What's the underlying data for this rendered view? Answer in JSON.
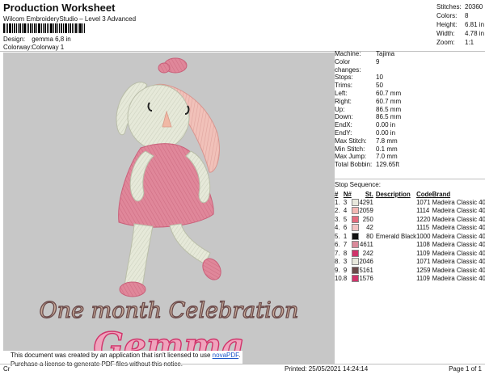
{
  "header": {
    "title": "Production Worksheet",
    "software": "Wilcom EmbroideryStudio – Level 3 Advanced",
    "design_label": "Design:",
    "design_value": "gemma 6,8 in",
    "colorway_label": "Colorway:",
    "colorway_value": "Colorway 1"
  },
  "stats": [
    {
      "k": "Stitches:",
      "v": "20360"
    },
    {
      "k": "Colors:",
      "v": "8"
    },
    {
      "k": "Height:",
      "v": "6.81 in"
    },
    {
      "k": "Width:",
      "v": "4.78 in"
    },
    {
      "k": "Zoom:",
      "v": "1:1"
    }
  ],
  "info": [
    {
      "k": "Machine:",
      "v": "Tajima"
    },
    {
      "k": "Color changes:",
      "v": "9"
    },
    {
      "k": "Stops:",
      "v": "10"
    },
    {
      "k": "Trims:",
      "v": "50"
    },
    {
      "k": "Left:",
      "v": "60.7 mm"
    },
    {
      "k": "Right:",
      "v": "60.7 mm"
    },
    {
      "k": "Up:",
      "v": "86.5 mm"
    },
    {
      "k": "Down:",
      "v": "86.5 mm"
    },
    {
      "k": "EndX:",
      "v": "0.00 in"
    },
    {
      "k": "EndY:",
      "v": "0.00 in"
    },
    {
      "k": "Max Stitch:",
      "v": "7.8 mm"
    },
    {
      "k": "Min Stitch:",
      "v": "0.1 mm"
    },
    {
      "k": "Max Jump:",
      "v": "7.0 mm"
    },
    {
      "k": "Total Bobbin:",
      "v": "129.65ft"
    }
  ],
  "sequence": {
    "title": "Stop Sequence:",
    "headers": [
      "#",
      "N#",
      "St.",
      "Description",
      "Code",
      "Brand"
    ],
    "rows": [
      {
        "num": "1.",
        "n": "3",
        "color": "#e8e8dc",
        "st": "4291",
        "desc": "",
        "code": "1071",
        "brand": "Madeira Classic 40"
      },
      {
        "num": "2.",
        "n": "4",
        "color": "#f2b7b3",
        "st": "2059",
        "desc": "",
        "code": "1114",
        "brand": "Madeira Classic 40"
      },
      {
        "num": "3.",
        "n": "5",
        "color": "#e46b7e",
        "st": "250",
        "desc": "",
        "code": "1220",
        "brand": "Madeira Classic 40"
      },
      {
        "num": "4.",
        "n": "6",
        "color": "#f2c4c4",
        "st": "42",
        "desc": "",
        "code": "1115",
        "brand": "Madeira Classic 40"
      },
      {
        "num": "5.",
        "n": "1",
        "color": "#111111",
        "st": "80",
        "desc": "Emerald Black",
        "code": "1000",
        "brand": "Madeira Classic 40"
      },
      {
        "num": "6.",
        "n": "7",
        "color": "#d9899a",
        "st": "4611",
        "desc": "",
        "code": "1108",
        "brand": "Madeira Classic 40"
      },
      {
        "num": "7.",
        "n": "8",
        "color": "#d0336a",
        "st": "242",
        "desc": "",
        "code": "1109",
        "brand": "Madeira Classic 40"
      },
      {
        "num": "8.",
        "n": "3",
        "color": "#e8e8dc",
        "st": "2046",
        "desc": "",
        "code": "1071",
        "brand": "Madeira Classic 40"
      },
      {
        "num": "9.",
        "n": "9",
        "color": "#6b4a4a",
        "st": "5161",
        "desc": "",
        "code": "1259",
        "brand": "Madeira Classic 40"
      },
      {
        "num": "10.",
        "n": "8",
        "color": "#d0336a",
        "st": "1576",
        "desc": "",
        "code": "1109",
        "brand": "Madeira Classic 40"
      }
    ]
  },
  "artwork": {
    "line1": "One month Celebration",
    "line2": "Gemma"
  },
  "notice": {
    "text1": "This document was created by an application that isn't licensed to use ",
    "link": "novaPDF",
    "text1_end": ".",
    "text2": "Purchase a license to generate PDF files without this notice."
  },
  "footer": {
    "left": "Cr",
    "printed": "Printed: 25/05/2021 14:24:14",
    "page": "Page 1 of 1"
  }
}
